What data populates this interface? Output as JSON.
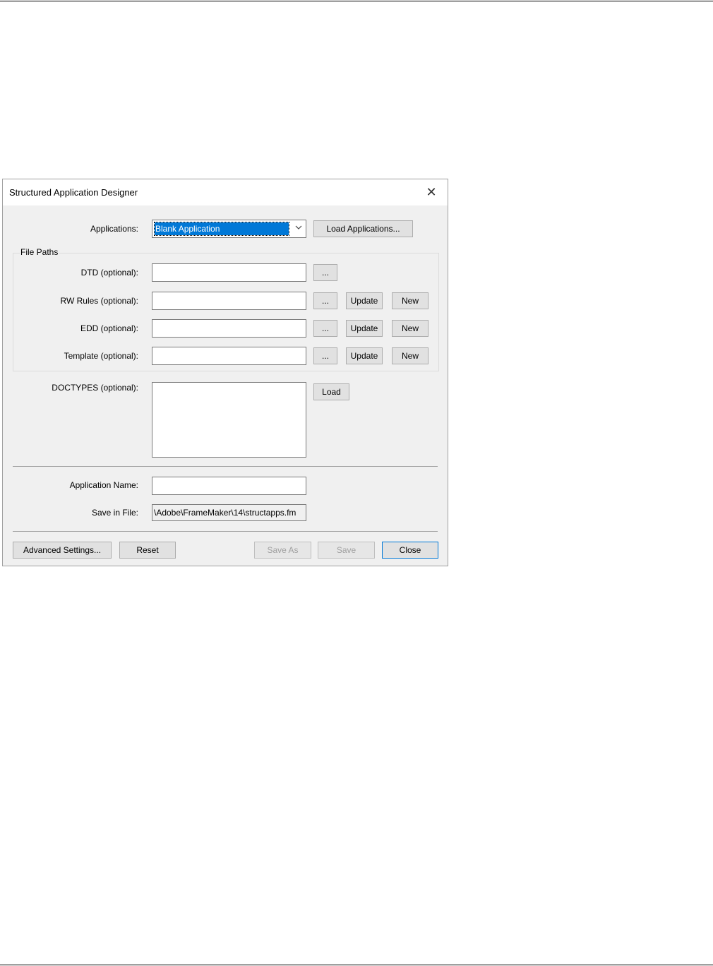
{
  "dialog": {
    "title": "Structured Application Designer",
    "close_glyph": "✕"
  },
  "applications": {
    "label": "Applications:",
    "selected": "Blank Application",
    "dropdown_icon": "chevron-down-icon",
    "load_button": "Load Applications..."
  },
  "file_paths": {
    "group_label": "File Paths",
    "rows": [
      {
        "label": "DTD (optional):",
        "value": "",
        "browse": "..."
      },
      {
        "label": "RW Rules (optional):",
        "value": "",
        "browse": "...",
        "update": "Update",
        "new": "New"
      },
      {
        "label": "EDD (optional):",
        "value": "",
        "browse": "...",
        "update": "Update",
        "new": "New"
      },
      {
        "label": "Template (optional):",
        "value": "",
        "browse": "...",
        "update": "Update",
        "new": "New"
      }
    ]
  },
  "doctypes": {
    "label": "DOCTYPES (optional):",
    "load_button": "Load"
  },
  "application_name": {
    "label": "Application Name:",
    "value": ""
  },
  "save_in_file": {
    "label": "Save in File:",
    "value": "\\Adobe\\FrameMaker\\14\\structapps.fm"
  },
  "footer": {
    "advanced": "Advanced Settings...",
    "reset": "Reset",
    "save_as": "Save As",
    "save": "Save",
    "close": "Close"
  }
}
